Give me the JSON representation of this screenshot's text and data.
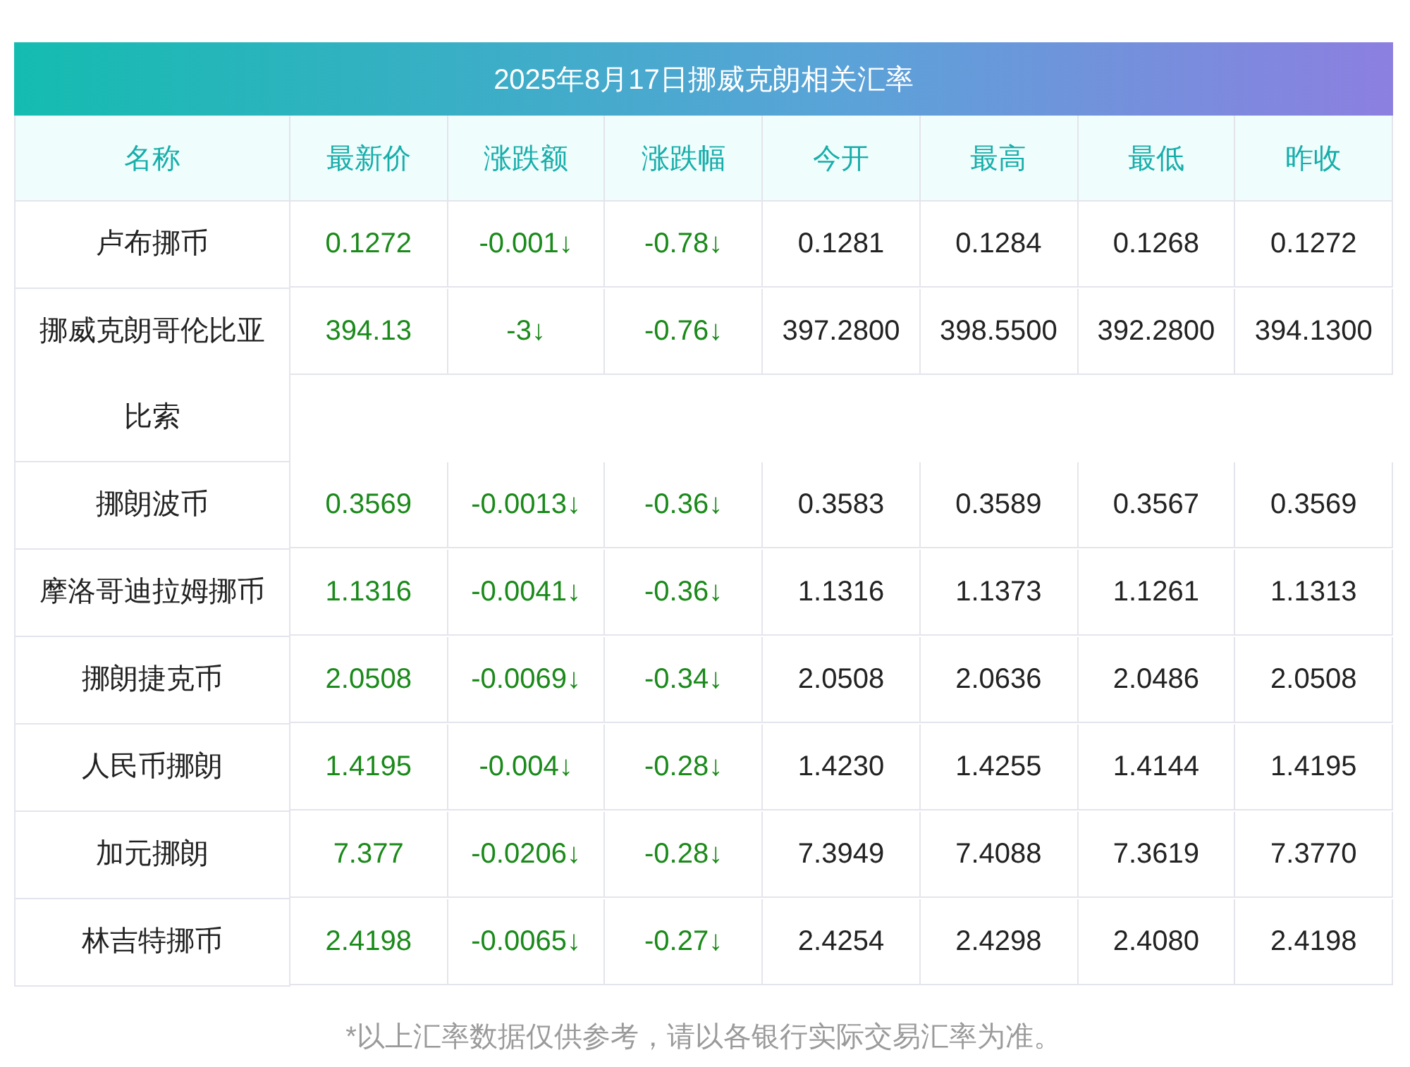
{
  "title": "2025年8月17日挪威克朗相关汇率",
  "columns": [
    "名称",
    "最新价",
    "涨跌额",
    "涨跌幅",
    "今开",
    "最高",
    "最低",
    "昨收"
  ],
  "rows": [
    {
      "name": "卢布挪币",
      "falling": true,
      "latest": "0.1272",
      "change": "-0.001↓",
      "change_pct": "-0.78↓",
      "open": "0.1281",
      "high": "0.1284",
      "low": "0.1268",
      "prev_close": "0.1272"
    },
    {
      "name": "挪威克朗哥伦比亚比索",
      "falling": true,
      "latest": "394.13",
      "change": "-3↓",
      "change_pct": "-0.76↓",
      "open": "397.2800",
      "high": "398.5500",
      "low": "392.2800",
      "prev_close": "394.1300"
    },
    {
      "name": "挪朗波币",
      "falling": true,
      "latest": "0.3569",
      "change": "-0.0013↓",
      "change_pct": "-0.36↓",
      "open": "0.3583",
      "high": "0.3589",
      "low": "0.3567",
      "prev_close": "0.3569"
    },
    {
      "name": "摩洛哥迪拉姆挪币",
      "falling": true,
      "latest": "1.1316",
      "change": "-0.0041↓",
      "change_pct": "-0.36↓",
      "open": "1.1316",
      "high": "1.1373",
      "low": "1.1261",
      "prev_close": "1.1313"
    },
    {
      "name": "挪朗捷克币",
      "falling": true,
      "latest": "2.0508",
      "change": "-0.0069↓",
      "change_pct": "-0.34↓",
      "open": "2.0508",
      "high": "2.0636",
      "low": "2.0486",
      "prev_close": "2.0508"
    },
    {
      "name": "人民币挪朗",
      "falling": true,
      "latest": "1.4195",
      "change": "-0.004↓",
      "change_pct": "-0.28↓",
      "open": "1.4230",
      "high": "1.4255",
      "low": "1.4144",
      "prev_close": "1.4195"
    },
    {
      "name": "加元挪朗",
      "falling": true,
      "latest": "7.377",
      "change": "-0.0206↓",
      "change_pct": "-0.28↓",
      "open": "7.3949",
      "high": "7.4088",
      "low": "7.3619",
      "prev_close": "7.3770"
    },
    {
      "name": "林吉特挪币",
      "falling": true,
      "latest": "2.4198",
      "change": "-0.0065↓",
      "change_pct": "-0.27↓",
      "open": "2.4254",
      "high": "2.4298",
      "low": "2.4080",
      "prev_close": "2.4198"
    }
  ],
  "footnote": "*以上汇率数据仅供参考，请以各银行实际交易汇率为准。"
}
